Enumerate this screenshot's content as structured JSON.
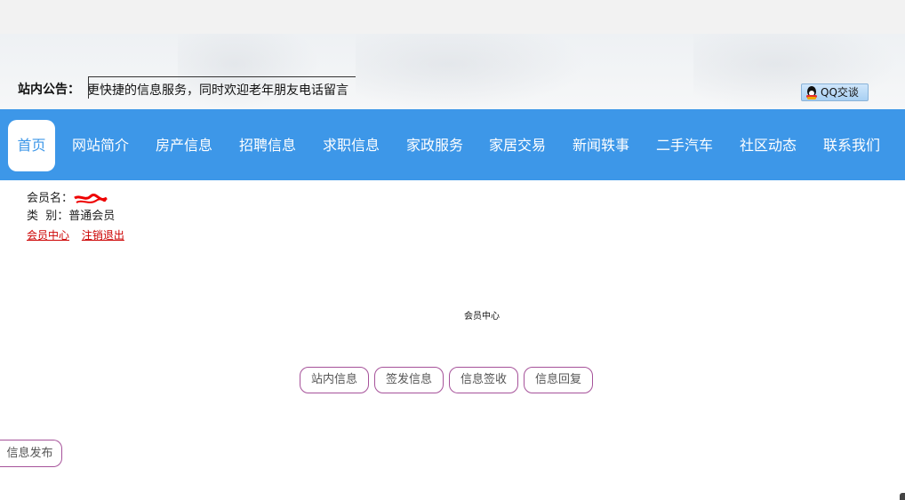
{
  "header": {
    "notice_label": "站内公告：",
    "notice_text": "更快捷的信息服务，同时欢迎老年朋友电话留言",
    "qq_button": "QQ交谈"
  },
  "nav": {
    "items": [
      {
        "label": "首页",
        "active": true
      },
      {
        "label": "网站简介"
      },
      {
        "label": "房产信息"
      },
      {
        "label": "招聘信息"
      },
      {
        "label": "求职信息"
      },
      {
        "label": "家政服务"
      },
      {
        "label": "家居交易"
      },
      {
        "label": "新闻轶事"
      },
      {
        "label": "二手汽车"
      },
      {
        "label": "社区动态"
      },
      {
        "label": "联系我们"
      }
    ],
    "bar_color": "#3d97e8"
  },
  "member": {
    "name_label": "会员名：",
    "type_label": "类  别：",
    "type_value": "普通会员",
    "link_center": "会员中心",
    "link_logout": "注销退出"
  },
  "center": {
    "title": "会员中心",
    "buttons": [
      "站内信息",
      "签发信息",
      "信息签收",
      "信息回复"
    ],
    "publish_button": "信息发布"
  },
  "colors": {
    "button_border": "#a6529a",
    "link": "#cc0000"
  }
}
